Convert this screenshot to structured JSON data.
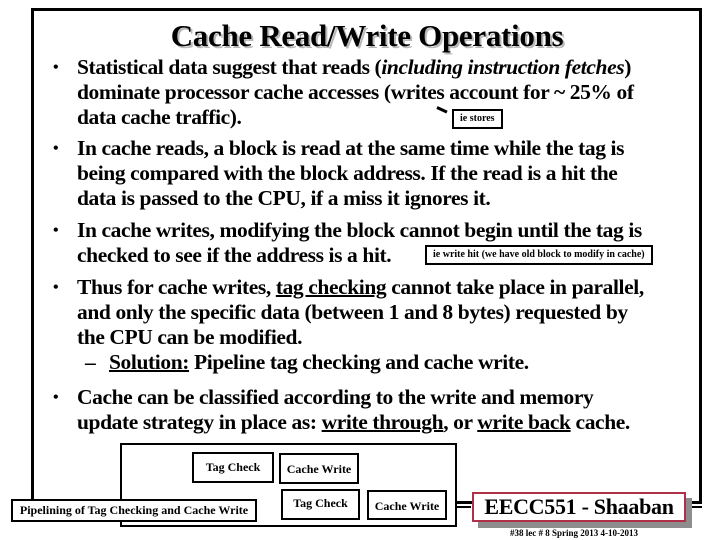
{
  "slide": {
    "title": "Cache Read/Write Operations",
    "bullet_glyph": "•",
    "dash_glyph": "–",
    "bullets": [
      {
        "line1_pre": "Statistical data suggest that reads (",
        "line1_italic": "including instruction fetches",
        "line1_post": ")",
        "line2": "dominate processor cache accesses  (writes account for ~ 25% of",
        "line3": "data cache traffic)."
      },
      {
        "line1": "In cache reads, a block is read at the same time while the tag is",
        "line2": "being compared with the block address.  If the read is a hit the",
        "line3": "data is passed to the CPU, if a miss it ignores it."
      },
      {
        "line1": "In cache writes, modifying the block cannot begin until the tag is",
        "line2": "checked to see if the address is a hit."
      },
      {
        "line1_pre": "Thus for cache writes, ",
        "line1_underline": "tag checking",
        "line1_post": " cannot take place in parallel,",
        "line2": "and only the specific data (between 1 and 8 bytes) requested by",
        "line3": "the CPU can be modified.",
        "sub_label": "Solution:",
        "sub_text": " Pipeline tag checking and cache write."
      },
      {
        "line1": "Cache can be classified according to the write and memory",
        "line2_pre": "update strategy in place as:  ",
        "line2_u1": "write through",
        "line2_mid": ", or ",
        "line2_u2": "write back",
        "line2_post": "  cache."
      }
    ],
    "notes": {
      "stores": "ie stores",
      "write_hit": "ie write hit  (we have old block to modify in cache)"
    },
    "diagram": {
      "caption": "Pipelining of Tag Checking and Cache Write",
      "stages": [
        "Tag Check",
        "Cache Write",
        "Tag Check",
        "Cache Write"
      ]
    },
    "badge": {
      "text": "EECC551 - Shaaban",
      "border_color": "#b0304a"
    },
    "footer": "#38   lec # 8    Spring 2013   4-10-2013"
  }
}
